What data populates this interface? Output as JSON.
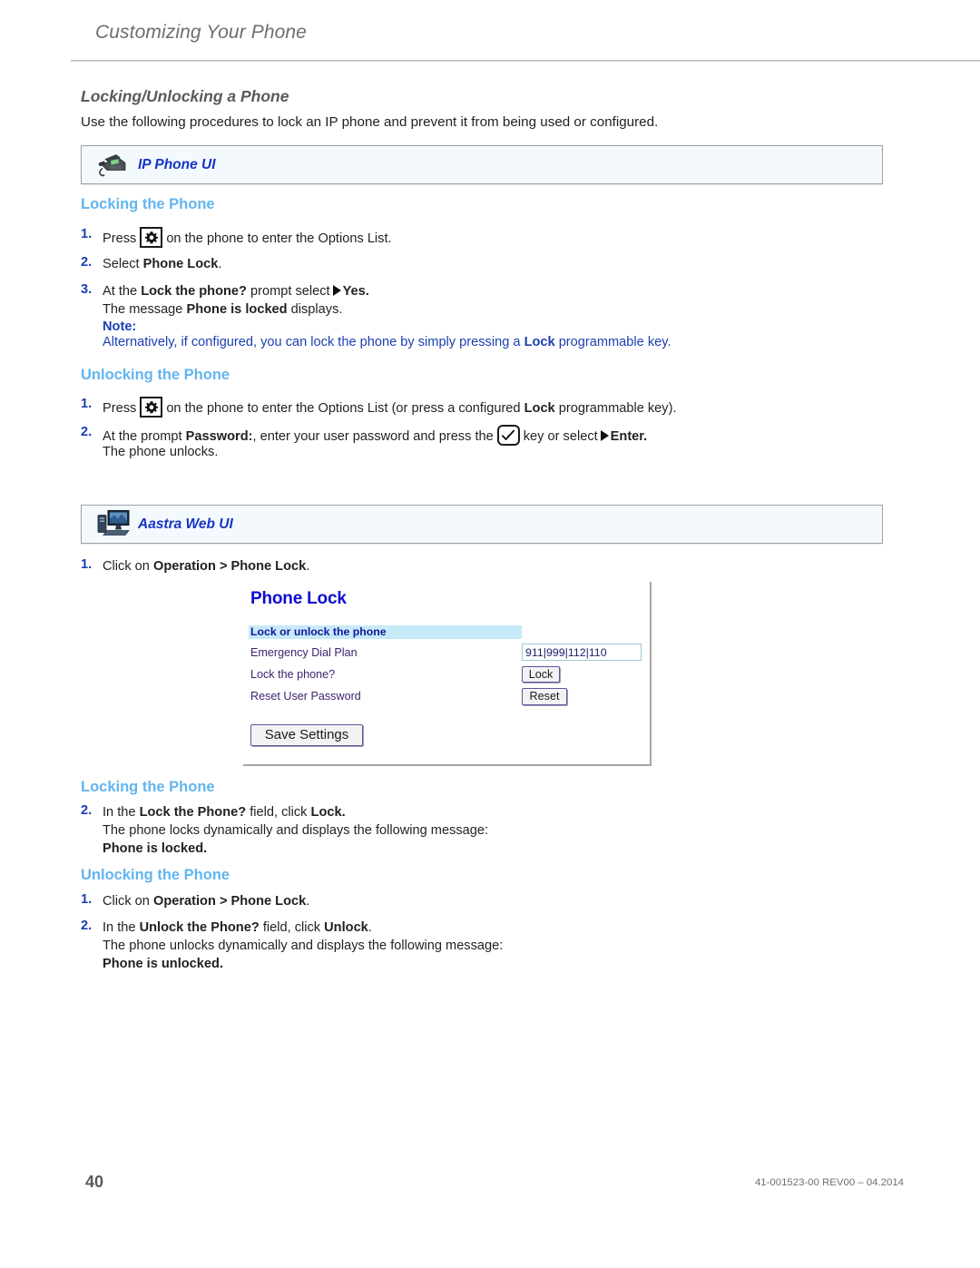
{
  "header": {
    "title": "Customizing Your Phone"
  },
  "section": {
    "title": "Locking/Unlocking a Phone",
    "intro": "Use the following procedures to lock an IP phone and prevent it from being used or configured."
  },
  "banners": {
    "ip_phone_ui": {
      "label": "IP Phone UI",
      "icon": "desk-phone-icon"
    },
    "aastra_web_ui": {
      "label": "Aastra Web UI",
      "icon": "desktop-computer-icon"
    }
  },
  "ipui_locking": {
    "heading": "Locking the Phone",
    "steps": [
      {
        "num": "1.",
        "pre": "Press",
        "key": "options-gear-key",
        "post": "on the phone to enter the Options List."
      },
      {
        "num": "2.",
        "pre": "Select",
        "bold": "Phone Lock",
        "post": "."
      },
      {
        "num": "3.",
        "pre": "At the",
        "bold": "Lock the phone?",
        "mid": "prompt select",
        "bold2": "Yes.",
        "line2_pre": "The message",
        "line2_bold": "Phone is locked",
        "line2_post": "displays."
      }
    ],
    "note": {
      "label": "Note:",
      "pre": "Alternatively, if configured, you can lock the phone by simply pressing a",
      "bold": "Lock",
      "post": "programmable key."
    }
  },
  "ipui_unlocking": {
    "heading": "Unlocking the Phone",
    "steps": [
      {
        "num": "1.",
        "pre": "Press",
        "key": "options-gear-key",
        "post": "on the phone to enter the Options List (or press a configured",
        "bold": "Lock",
        "post2": "programmable key)."
      },
      {
        "num": "2.",
        "pre": "At the prompt",
        "bold": "Password:",
        "mid": ", enter your user password and press the",
        "key": "checkmark-key",
        "mid2": "key or select",
        "bold2": "Enter.",
        "line2": "The phone unlocks."
      }
    ]
  },
  "webui_step1": {
    "num": "1.",
    "pre": "Click on",
    "bold": "Operation > Phone Lock",
    "post": "."
  },
  "web_screenshot": {
    "title": "Phone Lock",
    "section_header": "Lock or unlock the phone",
    "rows": [
      {
        "label": "Emergency Dial Plan",
        "control": "input",
        "value": "911|999|112|110"
      },
      {
        "label": "Lock the phone?",
        "control": "button",
        "value": "Lock"
      },
      {
        "label": "Reset User Password",
        "control": "button",
        "value": "Reset"
      }
    ],
    "save_button": "Save Settings"
  },
  "webui_locking": {
    "heading": "Locking the Phone",
    "step": {
      "num": "2.",
      "pre": "In the",
      "bold": "Lock the Phone?",
      "mid": "field, click",
      "bold2": "Lock.",
      "line2": "The phone locks dynamically and displays the following message:",
      "line3": "Phone is locked."
    }
  },
  "webui_unlocking": {
    "heading": "Unlocking the Phone",
    "steps": [
      {
        "num": "1.",
        "pre": "Click on",
        "bold": "Operation > Phone Lock",
        "post": "."
      },
      {
        "num": "2.",
        "pre": "In the",
        "bold": "Unlock the Phone?",
        "mid": "field, click",
        "bold2": "Unlock",
        "post": ".",
        "line2": "The phone unlocks dynamically and displays the following message:",
        "line3": "Phone is unlocked."
      }
    ]
  },
  "footer": {
    "page_number": "40",
    "doc_code": "41-001523-00 REV00 – 04.2014"
  },
  "colors": {
    "subhead_blue": "#62b5ef",
    "step_blue": "#1b3fb0",
    "banner_label_blue": "#1534c4",
    "header_gray": "#6e6e72",
    "webshot_title_blue": "#0b0bd0",
    "webshot_band": "#c7eaf8"
  }
}
